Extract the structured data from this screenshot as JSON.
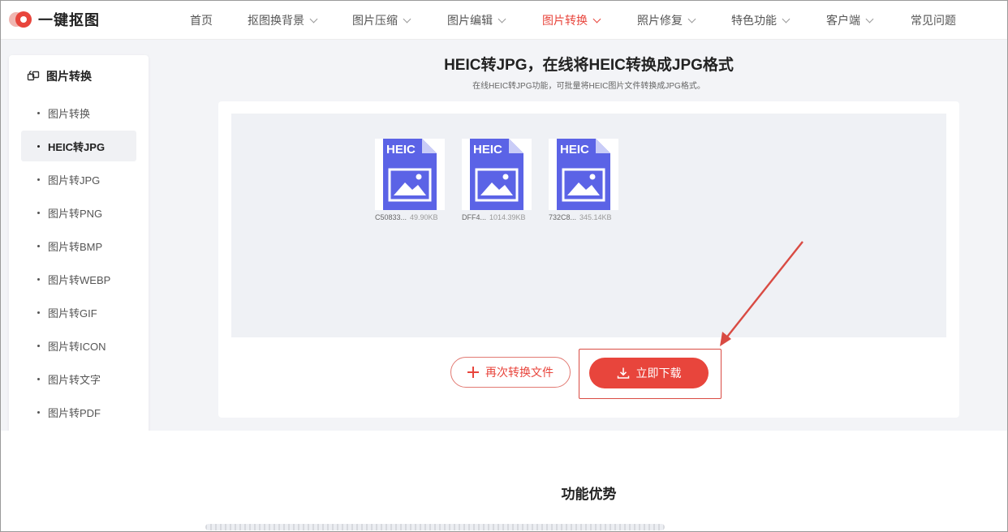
{
  "brand": {
    "name": "一键抠图"
  },
  "nav": {
    "items": [
      {
        "label": "首页",
        "dropdown": false,
        "active": false
      },
      {
        "label": "抠图换背景",
        "dropdown": true,
        "active": false
      },
      {
        "label": "图片压缩",
        "dropdown": true,
        "active": false
      },
      {
        "label": "图片编辑",
        "dropdown": true,
        "active": false
      },
      {
        "label": "图片转换",
        "dropdown": true,
        "active": true
      },
      {
        "label": "照片修复",
        "dropdown": true,
        "active": false
      },
      {
        "label": "特色功能",
        "dropdown": true,
        "active": false
      },
      {
        "label": "客户端",
        "dropdown": true,
        "active": false
      },
      {
        "label": "常见问题",
        "dropdown": false,
        "active": false
      }
    ]
  },
  "sidebar": {
    "title": "图片转换",
    "items": [
      {
        "label": "图片转换",
        "active": false
      },
      {
        "label": "HEIC转JPG",
        "active": true
      },
      {
        "label": "图片转JPG",
        "active": false
      },
      {
        "label": "图片转PNG",
        "active": false
      },
      {
        "label": "图片转BMP",
        "active": false
      },
      {
        "label": "图片转WEBP",
        "active": false
      },
      {
        "label": "图片转GIF",
        "active": false
      },
      {
        "label": "图片转ICON",
        "active": false
      },
      {
        "label": "图片转文字",
        "active": false
      },
      {
        "label": "图片转PDF",
        "active": false
      }
    ]
  },
  "main": {
    "title": "HEIC转JPG，在线将HEIC转换成JPG格式",
    "subtitle": "在线HEIC转JPG功能，可批量将HEIC图片文件转换成JPG格式。",
    "files": [
      {
        "badge": "HEIC",
        "name": "C50833...",
        "size": "49.90KB"
      },
      {
        "badge": "HEIC",
        "name": "DFF4...",
        "size": "1014.39KB"
      },
      {
        "badge": "HEIC",
        "name": "732C8...",
        "size": "345.14KB"
      }
    ],
    "reconvert_label": "再次转换文件",
    "download_label": "立即下载"
  },
  "section": {
    "title": "功能优势"
  },
  "colors": {
    "accent": "#e8453c",
    "file_icon": "#5b63e6",
    "annotation": "#d94b43"
  }
}
